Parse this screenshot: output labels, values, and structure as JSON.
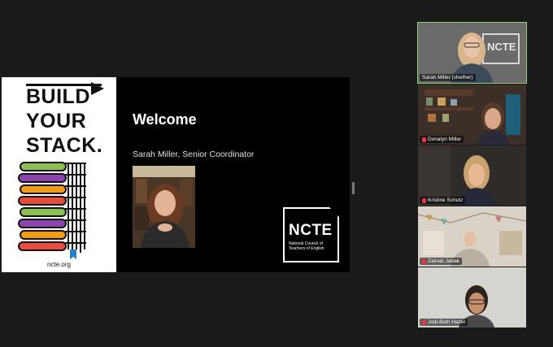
{
  "slide": {
    "logo_lines": [
      "BUILD",
      "YOUR",
      "STACK."
    ],
    "logo_url": "ncte.org",
    "welcome": "Welcome",
    "presenter": "Sarah Miller, Senior Coordinator",
    "ncte_title": "NCTE",
    "ncte_subtitle": "National Council of Teachers of English"
  },
  "participants": [
    {
      "name": "Sarah Miller (she/her)",
      "muted": false,
      "active": true,
      "watermark": "NCTE"
    },
    {
      "name": "Donalyn Miller",
      "muted": true,
      "active": false
    },
    {
      "name": "Kristine Schutz",
      "muted": true,
      "active": false
    },
    {
      "name": "Zainab Jabak",
      "muted": true,
      "active": false
    },
    {
      "name": "Jodi-Beth Hazel",
      "muted": true,
      "active": false
    }
  ],
  "colors": {
    "background": "#1a1a1a",
    "active_speaker": "#8fd17a",
    "book_colors": [
      "#8cc152",
      "#8e44ad",
      "#f39c12",
      "#e74c3c",
      "#8cc152",
      "#8e44ad",
      "#f39c12",
      "#e74c3c"
    ]
  }
}
